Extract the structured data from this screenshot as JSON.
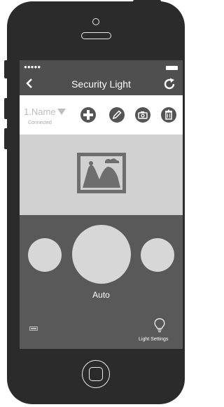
{
  "app": {
    "title": "Security Light",
    "carrier_dots": "●●●●●"
  },
  "nav": {
    "back_glyph": "‹"
  },
  "device": {
    "name": "1.Name",
    "status": "Connected"
  },
  "toolbar": {
    "add_icon": "plus-icon",
    "edit_icon": "pencil-icon",
    "camera_icon": "camera-icon",
    "delete_icon": "trash-icon"
  },
  "controls": {
    "mode_label": "Auto"
  },
  "footer": {
    "light_settings_label": "Light Settings"
  },
  "colors": {
    "phone_body": "#2b2b2b",
    "nav_bg": "#4f4f4f",
    "toolbar_bg": "#ffffff",
    "image_area_bg": "#d1d1d1",
    "control_area_bg": "#595959",
    "circle_fill": "#d7d7d7"
  }
}
